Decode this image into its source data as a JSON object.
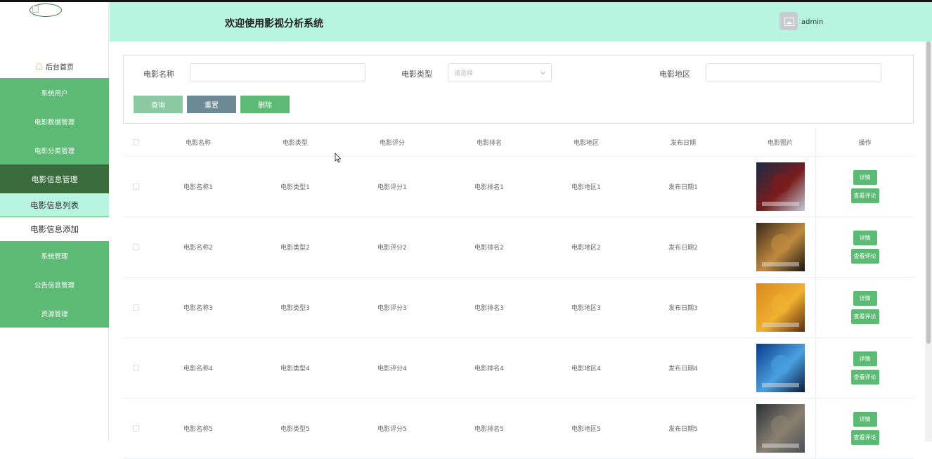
{
  "app": {
    "title": "欢迎使用影视分析系统",
    "username": "admin"
  },
  "sidebar": {
    "home": "后台首页",
    "items": [
      {
        "label": "系统用户"
      },
      {
        "label": "电影数据管理"
      },
      {
        "label": "电影分类管理"
      },
      {
        "label": "电影信息管理",
        "active": true
      }
    ],
    "subitems": [
      {
        "label": "电影信息列表",
        "selected": true
      },
      {
        "label": "电影信息添加"
      }
    ],
    "items_after": [
      {
        "label": "系统管理"
      },
      {
        "label": "公告信息管理"
      },
      {
        "label": "资源管理"
      }
    ]
  },
  "search": {
    "name_label": "电影名称",
    "name_value": "",
    "type_label": "电影类型",
    "type_placeholder": "请选择",
    "region_label": "电影地区",
    "region_value": "",
    "query_btn": "查询",
    "reset_btn": "重置",
    "delete_btn": "删除"
  },
  "colors": {
    "accent": "#5cba75",
    "header_bg": "#b8f5e1",
    "active_nav": "#3a6b3d",
    "reset": "#6c8a96",
    "query": "#8cc9a2"
  },
  "table": {
    "headers": [
      "电影名称",
      "电影类型",
      "电影评分",
      "电影排名",
      "电影地区",
      "发布日期",
      "电影图片",
      "操作"
    ],
    "rows": [
      {
        "name": "电影名称1",
        "type": "电影类型1",
        "score": "电影评分1",
        "rank": "电影排名1",
        "region": "电影地区1",
        "date": "发布日期1"
      },
      {
        "name": "电影名称2",
        "type": "电影类型2",
        "score": "电影评分2",
        "rank": "电影排名2",
        "region": "电影地区2",
        "date": "发布日期2"
      },
      {
        "name": "电影名称3",
        "type": "电影类型3",
        "score": "电影评分3",
        "rank": "电影排名3",
        "region": "电影地区3",
        "date": "发布日期3"
      },
      {
        "name": "电影名称4",
        "type": "电影类型4",
        "score": "电影评分4",
        "rank": "电影排名4",
        "region": "电影地区4",
        "date": "发布日期4"
      },
      {
        "name": "电影名称5",
        "type": "电影类型5",
        "score": "电影评分5",
        "rank": "电影排名5",
        "region": "电影地区5",
        "date": "发布日期5"
      }
    ],
    "detail_btn": "详情",
    "review_btn": "查看评论"
  }
}
